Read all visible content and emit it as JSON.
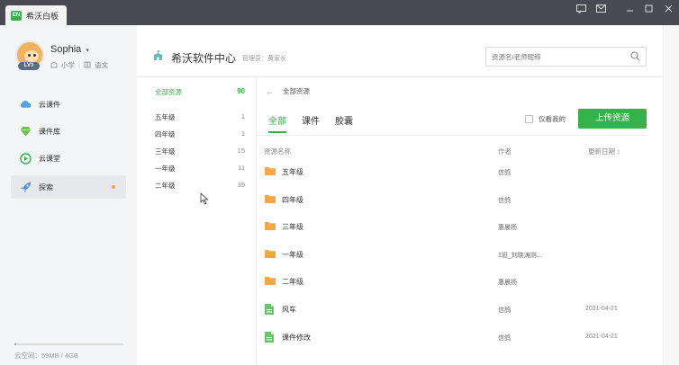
{
  "window": {
    "title": "希沃白板",
    "logo_text": "EN",
    "controls": [
      "feedback",
      "message",
      "minimize",
      "maximize",
      "close"
    ]
  },
  "user": {
    "name": "Sophia",
    "level": "LV3",
    "grade": "小学",
    "subject": "语文"
  },
  "nav": [
    {
      "label": "云课件",
      "icon": "cloud-icon",
      "active": false
    },
    {
      "label": "课件库",
      "icon": "gem-icon",
      "active": false
    },
    {
      "label": "云课堂",
      "icon": "play-icon",
      "active": false
    },
    {
      "label": "探索",
      "icon": "rocket-icon",
      "active": true
    }
  ],
  "storage": {
    "label": "云空间：59MB / 4GB",
    "used_fraction": 0.0144
  },
  "header": {
    "school": "希沃软件中心",
    "admin": "管理员：黄家长",
    "search_placeholder": "资源名/老师昵称"
  },
  "categories": [
    {
      "label": "全部资源",
      "count": "90",
      "active": true
    },
    {
      "label": "五年级",
      "count": "1"
    },
    {
      "label": "四年级",
      "count": "1"
    },
    {
      "label": "三年级",
      "count": "15"
    },
    {
      "label": "一年级",
      "count": "11"
    },
    {
      "label": "二年级",
      "count": "39"
    }
  ],
  "breadcrumb": "全部资源",
  "tabs": [
    "全部",
    "课件",
    "胶囊"
  ],
  "only_mine": "仅看我的",
  "upload": "上传资源",
  "columns": {
    "name": "资源名称",
    "author": "作者",
    "date": "更新日期 ↕"
  },
  "rows": [
    {
      "type": "folder",
      "name": "五年级",
      "author": "信鸽",
      "date": ""
    },
    {
      "type": "folder",
      "name": "四年级",
      "author": "信鸽",
      "date": ""
    },
    {
      "type": "folder",
      "name": "三年级",
      "author": "惠晨扬",
      "date": ""
    },
    {
      "type": "folder",
      "name": "一年级",
      "author": "1班_刘晓涛测...",
      "date": ""
    },
    {
      "type": "folder",
      "name": "二年级",
      "author": "惠晨扬",
      "date": ""
    },
    {
      "type": "file",
      "name": "风车",
      "author": "信鸽",
      "date": "2021-04-21"
    },
    {
      "type": "file",
      "name": "课件修改",
      "author": "信鸽",
      "date": "2021-04-21"
    }
  ],
  "colors": {
    "accent": "#34b34a",
    "folder": "#f5a744",
    "file": "#6cc26c"
  }
}
